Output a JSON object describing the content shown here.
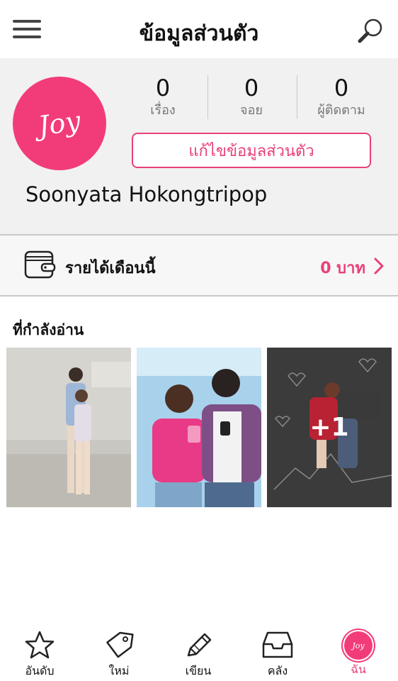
{
  "header": {
    "title": "ข้อมูลส่วนตัว"
  },
  "profile": {
    "avatar_text": "Joy",
    "stats": [
      {
        "value": "0",
        "label": "เรื่อง"
      },
      {
        "value": "0",
        "label": "จอย"
      },
      {
        "value": "0",
        "label": "ผู้ติดตาม"
      }
    ],
    "edit_button": "แก้ไขข้อมูลส่วนตัว",
    "username": "Soonyata Hokongtripop"
  },
  "income": {
    "label": "รายได้เดือนนี้",
    "value": "0 บาท"
  },
  "reading": {
    "title": "ที่กำลังอ่าน",
    "more_count": "+1"
  },
  "tabbar": {
    "tabs": [
      {
        "label": "อันดับ",
        "icon": "star-icon"
      },
      {
        "label": "ใหม่",
        "icon": "tag-icon"
      },
      {
        "label": "เขียน",
        "icon": "pencil-icon"
      },
      {
        "label": "คลัง",
        "icon": "inbox-icon"
      },
      {
        "label": "ฉัน",
        "icon": "profile-avatar-icon",
        "avatar_text": "Joy"
      }
    ],
    "active": "ฉัน"
  },
  "colors": {
    "accent": "#e8407a",
    "avatar": "#f23c79"
  }
}
